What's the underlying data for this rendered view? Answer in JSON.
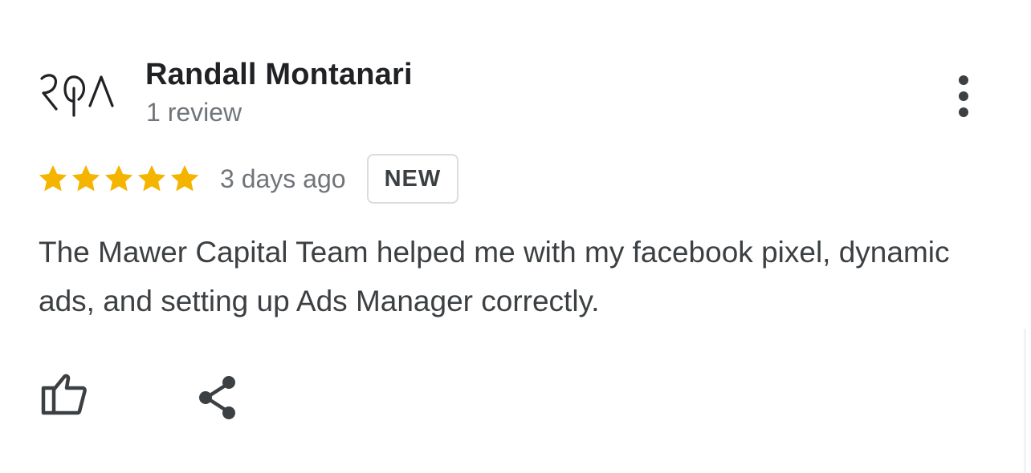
{
  "reviewer": {
    "name": "Randall Montanari",
    "review_count": "1 review",
    "avatar_icon": "reviewer-logo-icon"
  },
  "rating": {
    "stars": 5,
    "max_stars": 5,
    "star_color": "#f4b400",
    "time_ago": "3 days ago",
    "badge": "NEW"
  },
  "review": {
    "text": "The Mawer Capital Team helped me with my facebook pixel, dynamic ads, and setting up Ads Manager correctly."
  },
  "actions": {
    "like_icon": "thumbs-up-icon",
    "share_icon": "share-icon",
    "more_icon": "more-vert-icon"
  },
  "colors": {
    "name": "#202124",
    "secondary_text": "#70757a",
    "body_text": "#3c4043",
    "badge_border": "#dadce0"
  }
}
